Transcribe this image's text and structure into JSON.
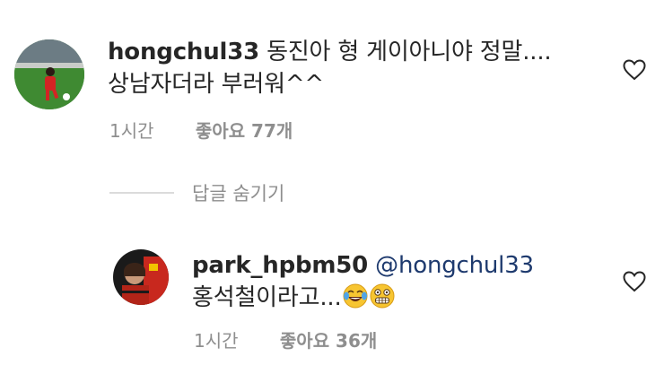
{
  "comments": [
    {
      "username": "hongchul33",
      "text_line1": "동진아 형 게이아니야 정말....",
      "text_line2": "상남자더라 부러워^^",
      "time": "1시간",
      "likes": "좋아요 77개",
      "avatar_icon": "soccer-player-avatar",
      "like_icon": "heart-outline-icon"
    },
    {
      "username": "park_hpbm50",
      "mention": "@hongchul33",
      "text": "홍석철이라고...",
      "emojis": [
        "face-with-tears-of-joy-icon",
        "grimacing-face-icon"
      ],
      "time": "1시간",
      "likes": "좋아요 36개",
      "avatar_icon": "red-jersey-avatar",
      "like_icon": "heart-outline-icon"
    }
  ],
  "replies_toggle": {
    "label": "답글 숨기기"
  },
  "colors": {
    "text": "#262626",
    "secondary": "#8e8e8e",
    "mention": "#1e3a6e",
    "divider": "#dbdbdb"
  }
}
